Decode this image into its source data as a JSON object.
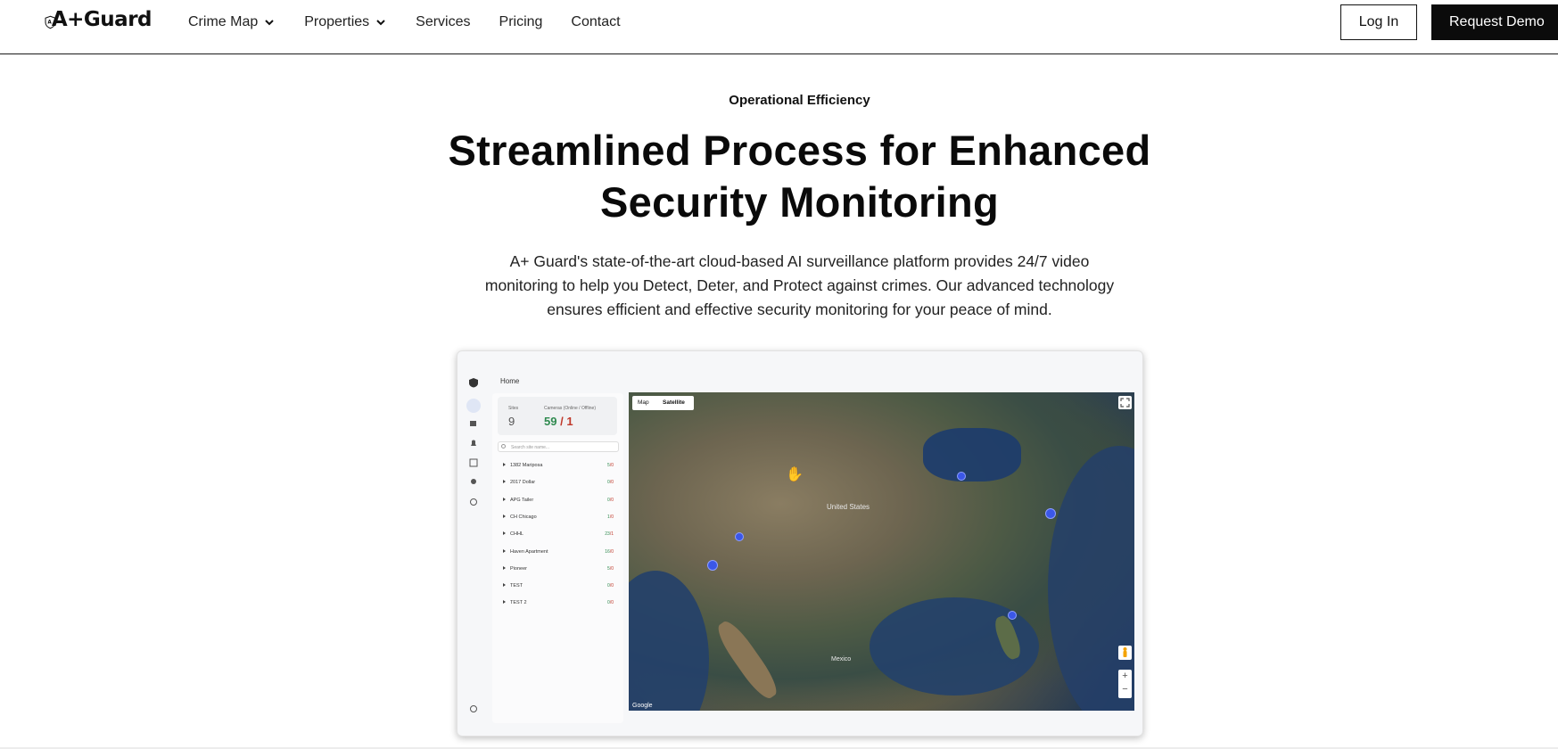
{
  "header": {
    "logo_text": "A+Guard",
    "nav": [
      {
        "label": "Crime Map",
        "has_dropdown": true
      },
      {
        "label": "Properties",
        "has_dropdown": true
      },
      {
        "label": "Services",
        "has_dropdown": false
      },
      {
        "label": "Pricing",
        "has_dropdown": false
      },
      {
        "label": "Contact",
        "has_dropdown": false
      }
    ],
    "login_label": "Log In",
    "demo_label": "Request Demo"
  },
  "hero": {
    "eyebrow": "Operational Efficiency",
    "headline_line1": "Streamlined Process for Enhanced",
    "headline_line2": "Security Monitoring",
    "lede_line1": "A+ Guard's state-of-the-art cloud-based AI surveillance platform provides 24/7 video",
    "lede_line2": "monitoring to help you Detect, Deter, and Protect against crimes. Our advanced technology",
    "lede_line3": "ensures efficient and effective security monitoring for your peace of mind."
  },
  "dashboard": {
    "breadcrumb": "Home",
    "stats": {
      "sites_label": "Sites",
      "sites_value": "9",
      "cameras_label": "Cameras (Online / Offline)",
      "cameras_online": "59",
      "cameras_sep": " / ",
      "cameras_offline": "1"
    },
    "search_placeholder": "Search site name...",
    "sites": [
      {
        "name": "1382 Mariposa",
        "online": "5",
        "offline": "0"
      },
      {
        "name": "2017 Dollar",
        "online": "0",
        "offline": "0"
      },
      {
        "name": "APG Tailer",
        "online": "0",
        "offline": "0"
      },
      {
        "name": "CH Chicago",
        "online": "1",
        "offline": "0"
      },
      {
        "name": "CHHL",
        "online": "23",
        "offline": "1"
      },
      {
        "name": "Haven Apartment",
        "online": "16",
        "offline": "0"
      },
      {
        "name": "Pioneer",
        "online": "5",
        "offline": "0"
      },
      {
        "name": "TEST",
        "online": "0",
        "offline": "0"
      },
      {
        "name": "TEST 2",
        "online": "0",
        "offline": "0"
      }
    ],
    "map": {
      "tab_map": "Map",
      "tab_satellite": "Satellite",
      "label_us": "United States",
      "label_mexico": "Mexico",
      "provider": "Google",
      "zoom_in": "+",
      "zoom_out": "−"
    }
  }
}
